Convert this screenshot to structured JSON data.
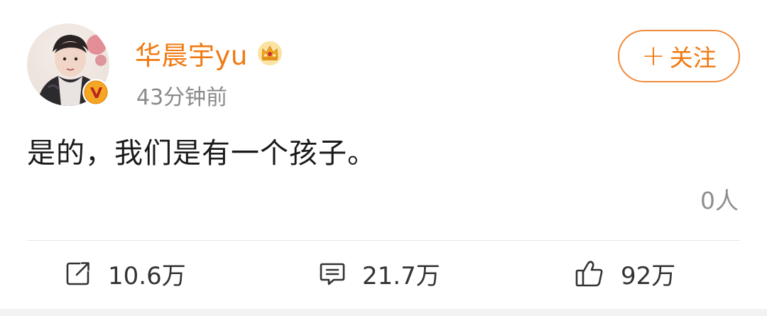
{
  "author": {
    "name": "华晨宇yu",
    "timestamp": "43分钟前",
    "avatar": "avatar",
    "verified_icon": "verified-v-icon",
    "membership_icon": "crown-icon"
  },
  "follow_button": {
    "plus": "+",
    "label": "关注"
  },
  "post": {
    "text": "是的，我们是有一个孩子。",
    "reader_count": "0人"
  },
  "actions": {
    "repost": {
      "icon": "repost-icon",
      "count": "10.6万"
    },
    "comment": {
      "icon": "comment-icon",
      "count": "21.7万"
    },
    "like": {
      "icon": "thumbs-up-icon",
      "count": "92万"
    }
  },
  "colors": {
    "accent": "#f07a12",
    "muted": "#8a8a8a",
    "text": "#1a1a1a",
    "badge": "#f5a623"
  }
}
